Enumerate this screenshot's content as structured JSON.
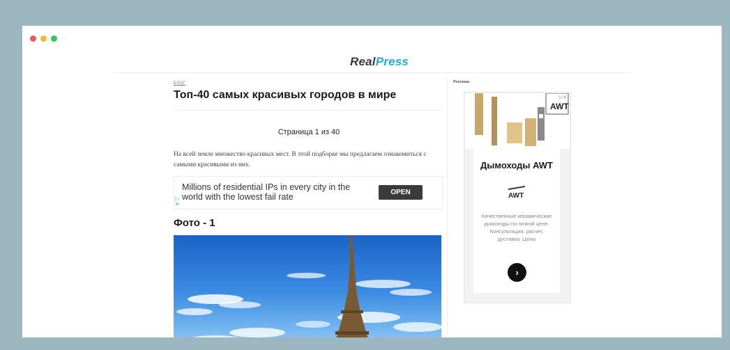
{
  "window": {
    "dots": [
      "close",
      "minimize",
      "maximize"
    ]
  },
  "site": {
    "logo_part1": "Real",
    "logo_part2": "Press"
  },
  "article": {
    "category": "блог",
    "title": "Топ-40 самых красивых городов в мире",
    "pager": "Страница 1 из 40",
    "intro": "На всей земле множество красивых мест. В этой подборке мы предлагаем ознакомиться с самыми красивыми из них.",
    "photo_heading": "Фото - 1"
  },
  "ad_banner": {
    "text": "Millions of residential IPs in every city in the world with the lowest fail rate",
    "button": "OPEN"
  },
  "sidebar": {
    "label": "Реклама",
    "ad_title": "Дымоходы AWT",
    "ad_logo": "AWT",
    "ad_description": "Качественные керамические дымоходы по низкой цене. Консультация, расчет, доставка. Цены",
    "ad_button_icon": "chevron-right-icon"
  },
  "colors": {
    "accent": "#24a9e1",
    "background": "#9db7c1",
    "button": "#3b3b3b"
  }
}
